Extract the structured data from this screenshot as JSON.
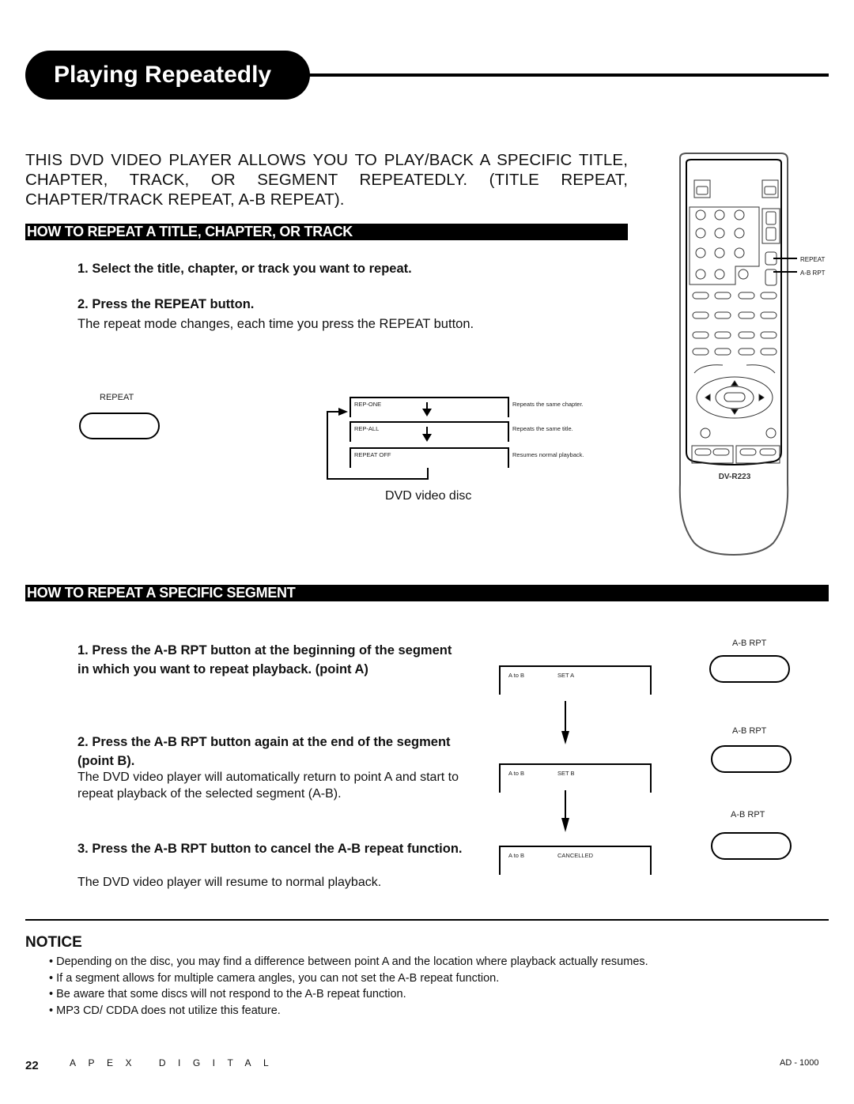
{
  "header": {
    "title": "Playing Repeatedly"
  },
  "intro": "THIS DVD VIDEO PLAYER ALLOWS YOU TO PLAY/BACK A SPECIFIC TITLE, CHAPTER, TRACK, OR SEGMENT REPEATEDLY. (TITLE REPEAT, CHAPTER/TRACK REPEAT, A-B REPEAT).",
  "section1": {
    "heading": "HOW TO REPEAT A TITLE, CHAPTER, OR TRACK",
    "step1": "1. Select the title, chapter, or track you want to repeat.",
    "step2": "2. Press the REPEAT button.",
    "step2_body": "The repeat mode changes, each time you press the REPEAT button.",
    "button_label": "REPEAT",
    "modes": [
      {
        "display": "REP-ONE",
        "description": "Repeats the same chapter."
      },
      {
        "display": "REP-ALL",
        "description": "Repeats the same title."
      },
      {
        "display": "REPEAT OFF",
        "description": "Resumes normal playback."
      }
    ],
    "caption": "DVD video disc"
  },
  "remote": {
    "callouts": [
      "REPEAT",
      "A-B RPT"
    ],
    "model": "DV-R223"
  },
  "section2": {
    "heading": "HOW TO REPEAT A SPECIFIC SEGMENT",
    "steps": [
      {
        "title": "1. Press the A-B RPT button at the beginning of the segment in which you want to repeat playback. (point A)",
        "body": ""
      },
      {
        "title": "2. Press the A-B RPT button again at the end of the segment (point B).",
        "body": "The DVD video player will automatically return to point A and start to repeat playback of the selected segment (A-B)."
      },
      {
        "title": "3. Press the A-B RPT button to cancel the A-B repeat function.",
        "body": "The DVD video player will resume to normal playback."
      }
    ],
    "displays": [
      {
        "left": "A to B",
        "right": "SET A"
      },
      {
        "left": "A to B",
        "right": "SET B"
      },
      {
        "left": "A to B",
        "right": "CANCELLED"
      }
    ],
    "button_label": "A-B RPT"
  },
  "notice": {
    "title": "NOTICE",
    "items": [
      "Depending on the disc, you may find a difference between point A and the location where playback actually resumes.",
      "If a segment allows for multiple camera angles, you can not set the A-B repeat function.",
      "Be aware that some discs will not respond to the A-B repeat function.",
      "MP3 CD/ CDDA does not utilize this feature."
    ]
  },
  "footer": {
    "page": "22",
    "brand": "APEX DIGITAL",
    "model": "AD - 1000"
  }
}
